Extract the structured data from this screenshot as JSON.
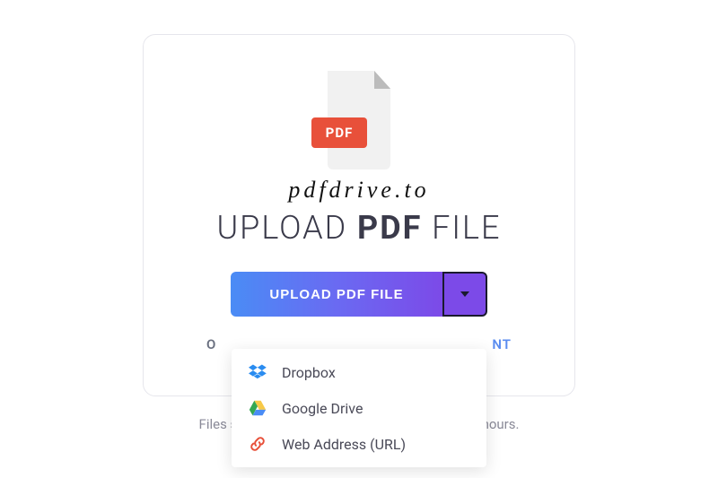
{
  "watermark": "pdfdrive.to",
  "pdf_badge": "PDF",
  "heading": {
    "pre": "UPLOAD ",
    "bold": "PDF",
    "post": " FILE"
  },
  "upload_button": "UPLOAD PDF FILE",
  "obscured": {
    "left": "O",
    "right": "NT"
  },
  "menu": {
    "dropbox": "Dropbox",
    "gdrive": "Google Drive",
    "url": "Web Address (URL)"
  },
  "footer": "Files stay private. Automatically deleted after 5 hours."
}
